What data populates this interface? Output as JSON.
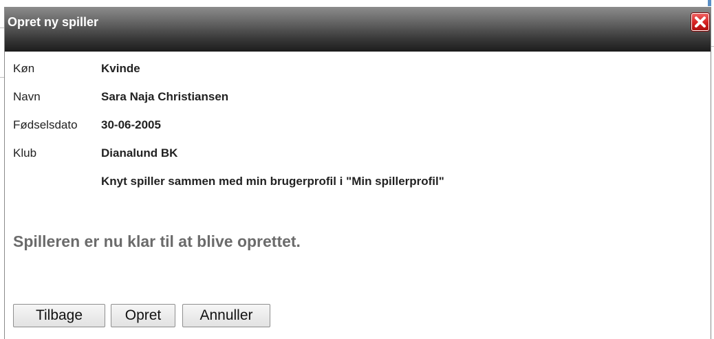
{
  "dialog": {
    "title": "Opret ny spiller",
    "close_icon": "close-x-icon"
  },
  "player": {
    "gender": {
      "label": "Køn",
      "value": "Kvinde"
    },
    "name": {
      "label": "Navn",
      "value": "Sara Naja Christiansen"
    },
    "birthdate": {
      "label": "Fødselsdato",
      "value": "30-06-2005"
    },
    "club": {
      "label": "Klub",
      "value": "Dianalund BK"
    },
    "link_note": "Knyt spiller sammen med min brugerprofil i \"Min spillerprofil\""
  },
  "status_message": "Spilleren er nu klar til at blive oprettet.",
  "buttons": {
    "back": "Tilbage",
    "create": "Opret",
    "cancel": "Annuller"
  },
  "colors": {
    "close_button": "#d42020",
    "titlebar_top": "#8c8c8c",
    "titlebar_bottom": "#1c1c1c",
    "status_text": "#6b6b6b"
  }
}
